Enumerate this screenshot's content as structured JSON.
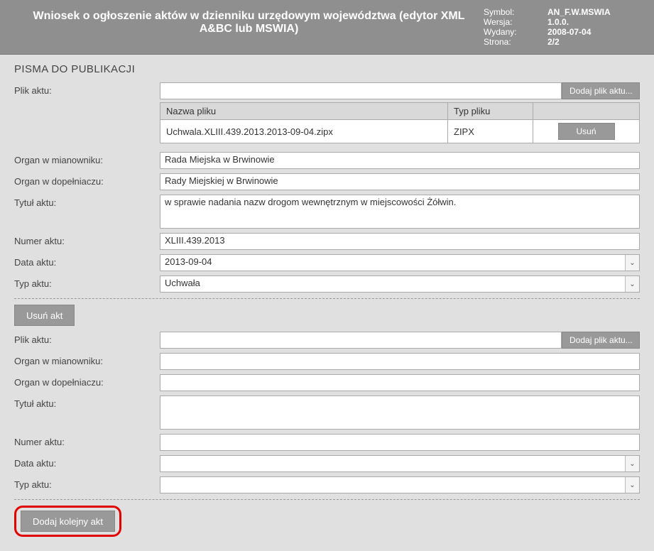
{
  "header": {
    "title": "Wniosek o ogłoszenie aktów w dzienniku urzędowym województwa (edytor XML A&BC lub MSWIA)",
    "meta": {
      "symbol_label": "Symbol:",
      "symbol_value": "AN_F.W.MSWIA",
      "version_label": "Wersja:",
      "version_value": "1.0.0.",
      "issued_label": "Wydany:",
      "issued_value": "2008-07-04",
      "page_label": "Strona:",
      "page_value": "2/2"
    }
  },
  "section_title": "PISMA DO PUBLIKACJI",
  "labels": {
    "plik_aktu": "Plik aktu:",
    "organ_mian": "Organ w mianowniku:",
    "organ_dop": "Organ w dopełniaczu:",
    "tytul": "Tytuł aktu:",
    "numer": "Numer aktu:",
    "data": "Data aktu:",
    "typ": "Typ aktu:"
  },
  "buttons": {
    "dodaj_plik": "Dodaj plik aktu...",
    "usun": "Usuń",
    "usun_akt": "Usuń akt",
    "dodaj_kolejny": "Dodaj kolejny akt"
  },
  "file_table": {
    "col_name": "Nazwa pliku",
    "col_type": "Typ pliku",
    "col_actions": " ",
    "rows": [
      {
        "name": "Uchwala.XLIII.439.2013.2013-09-04.zipx",
        "type": "ZIPX"
      }
    ]
  },
  "akty": [
    {
      "plik": "",
      "organ_mian": "Rada Miejska w Brwinowie",
      "organ_dop": "Rady Miejskiej w Brwinowie",
      "tytul": "w sprawie nadania nazw drogom wewnętrznym w miejscowości Żółwin.",
      "numer": "XLIII.439.2013",
      "data": "2013-09-04",
      "typ": "Uchwała"
    },
    {
      "plik": "",
      "organ_mian": "",
      "organ_dop": "",
      "tytul": "",
      "numer": "",
      "data": "",
      "typ": ""
    }
  ]
}
